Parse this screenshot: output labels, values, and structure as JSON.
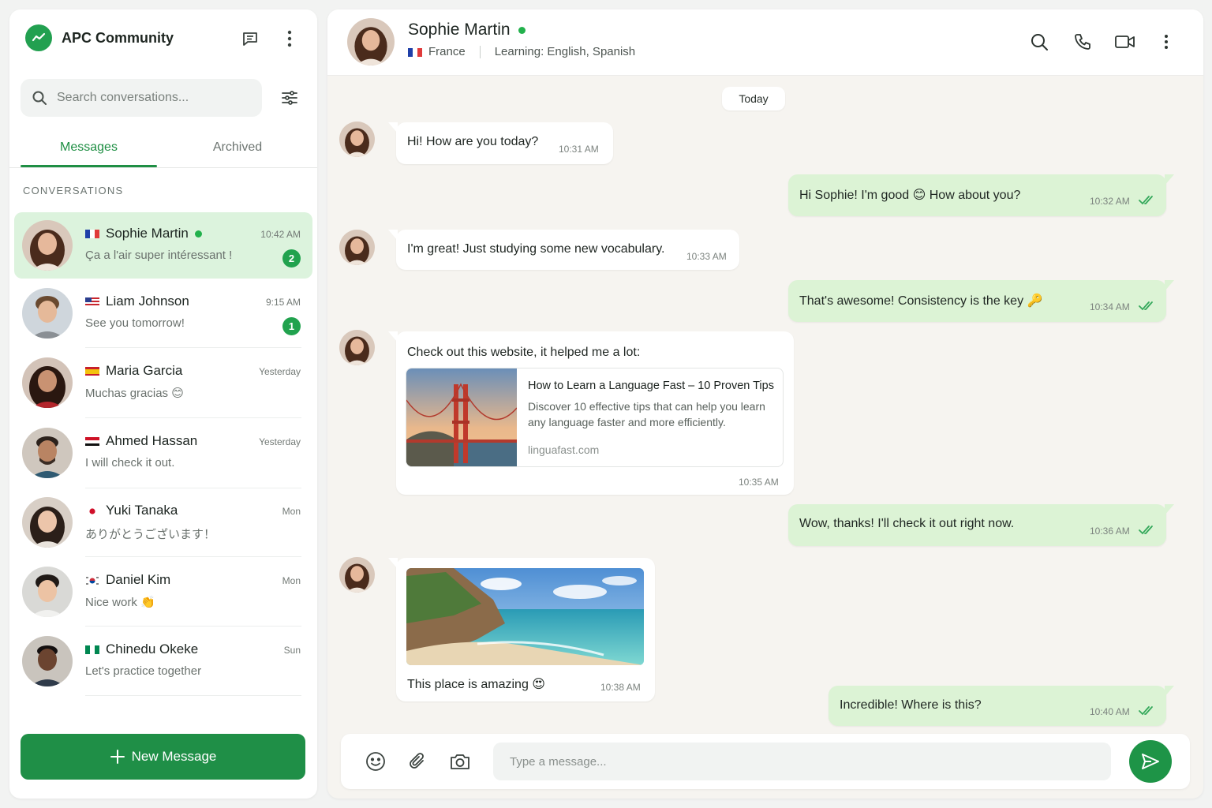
{
  "app": {
    "name": "APC Community",
    "brand_color": "#22a050"
  },
  "search": {
    "placeholder": "Search conversations..."
  },
  "tabs": [
    {
      "label": "Messages",
      "active": true
    },
    {
      "label": "Archived",
      "active": false
    }
  ],
  "section_label": "CONVERSATIONS",
  "conversations": [
    {
      "name": "Sophie Martin",
      "flag": "france",
      "online": true,
      "time": "10:42 AM",
      "preview": "Ça a l'air super intéressant !",
      "unread": "2",
      "active": true
    },
    {
      "name": "Liam Johnson",
      "flag": "usa",
      "online": false,
      "time": "9:15 AM",
      "preview": "See you tomorrow!",
      "unread": "1",
      "active": false
    },
    {
      "name": "Maria Garcia",
      "flag": "spain",
      "online": false,
      "time": "Yesterday",
      "preview": "Muchas gracias",
      "emoji": "😊",
      "active": false
    },
    {
      "name": "Ahmed Hassan",
      "flag": "egypt",
      "online": false,
      "time": "Yesterday",
      "preview": "I will check it out.",
      "active": false
    },
    {
      "name": "Yuki Tanaka",
      "flag": "japan",
      "online": false,
      "time": "Mon",
      "preview": "ありがとうございます！",
      "active": false
    },
    {
      "name": "Daniel Kim",
      "flag": "korea",
      "online": false,
      "time": "Mon",
      "preview": "Nice work",
      "emoji": "👏",
      "active": false
    },
    {
      "name": "Chinedu Okeke",
      "flag": "nigeria",
      "online": false,
      "time": "Sun",
      "preview": "Let's practice together",
      "active": false
    }
  ],
  "new_message_label": "New Message",
  "chat": {
    "contact": {
      "name": "Sophie Martin",
      "online": true,
      "country": "France",
      "learning": "Learning: English, Spanish"
    },
    "date_separator": "Today",
    "messages": [
      {
        "dir": "in",
        "text": "Hi! How are you today?",
        "time": "10:31 AM"
      },
      {
        "dir": "out",
        "text_before": "Hi Sophie! I'm good",
        "emoji": "😊",
        "text_after": "How about you?",
        "time": "10:32 AM",
        "status": "read"
      },
      {
        "dir": "in",
        "text": "I'm great! Just studying some new vocabulary.",
        "time": "10:33 AM"
      },
      {
        "dir": "out",
        "text": "That's awesome! Consistency is the key",
        "emoji": "🔑",
        "time": "10:34 AM",
        "status": "read"
      },
      {
        "dir": "in",
        "text": "Check out this website, it helped me a lot:",
        "time": "10:35 AM",
        "link": {
          "title": "How to Learn a Language Fast – 10 Proven Tips",
          "description": "Discover 10 effective tips that can help you learn any language faster and more efficiently.",
          "domain": "linguafast.com"
        }
      },
      {
        "dir": "out",
        "text": "Wow, thanks! I'll check it out right now.",
        "time": "10:36 AM",
        "status": "read"
      },
      {
        "dir": "in",
        "text": "This place is amazing",
        "emoji": "😍",
        "time": "10:38 AM",
        "has_image": true
      },
      {
        "dir": "out",
        "text": "Incredible! Where is this?",
        "time": "10:40 AM",
        "status": "read"
      }
    ]
  },
  "composer": {
    "placeholder": "Type a message..."
  },
  "colors": {
    "accent": "#1f8f47",
    "bubble_out": "#dcf3d5",
    "active_conv": "#dcf3dd",
    "online": "#22b14c"
  }
}
